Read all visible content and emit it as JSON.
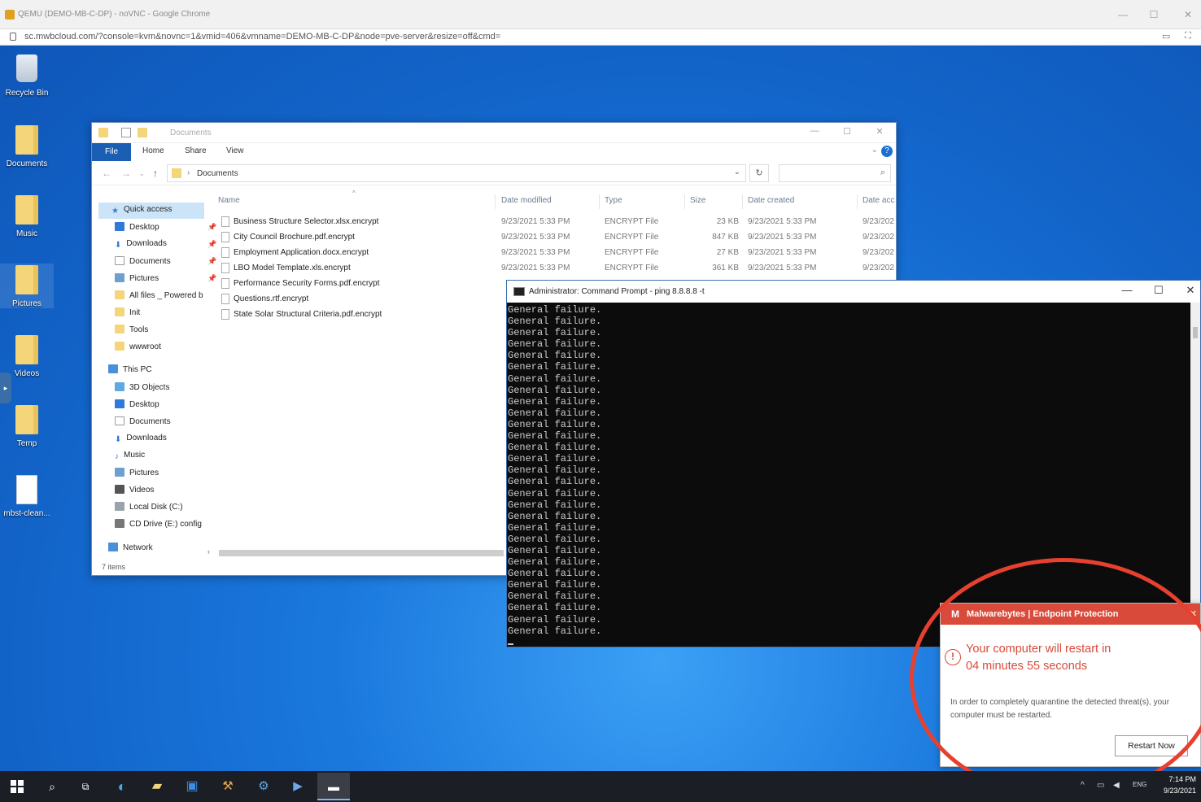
{
  "browser": {
    "title": "QEMU (DEMO-MB-C-DP) - noVNC - Google Chrome",
    "url": "sc.mwbcloud.com/?console=kvm&novnc=1&vmid=406&vmname=DEMO-MB-C-DP&node=pve-server&resize=off&cmd="
  },
  "desktop_icons": [
    {
      "label": "Recycle Bin",
      "icon": "recycle-bin-icon"
    },
    {
      "label": "Documents",
      "icon": "folder-icon"
    },
    {
      "label": "Music",
      "icon": "folder-icon"
    },
    {
      "label": "Pictures",
      "icon": "folder-icon"
    },
    {
      "label": "Videos",
      "icon": "folder-icon"
    },
    {
      "label": "Temp",
      "icon": "folder-icon"
    },
    {
      "label": "mbst-clean...",
      "icon": "file-icon"
    }
  ],
  "explorer": {
    "title": "Documents",
    "ribbon": {
      "file": "File",
      "home": "Home",
      "share": "Share",
      "view": "View"
    },
    "breadcrumb": "Documents",
    "nav": {
      "quick_access": "Quick access",
      "quick_items": [
        "Desktop",
        "Downloads",
        "Documents",
        "Pictures",
        "All files _ Powered b",
        "Init",
        "Tools",
        "wwwroot"
      ],
      "this_pc": "This PC",
      "pc_items": [
        "3D Objects",
        "Desktop",
        "Documents",
        "Downloads",
        "Music",
        "Pictures",
        "Videos",
        "Local Disk (C:)",
        "CD Drive (E:) config"
      ],
      "network": "Network"
    },
    "status": "7 items",
    "columns": {
      "name": "Name",
      "date_modified": "Date modified",
      "type": "Type",
      "size": "Size",
      "date_created": "Date created",
      "date_accessed": "Date acc"
    },
    "files": [
      {
        "name": "Business Structure Selector.xlsx.encrypt",
        "modified": "9/23/2021 5:33 PM",
        "type": "ENCRYPT File",
        "size": "23 KB",
        "created": "9/23/2021 5:33 PM",
        "accessed": "9/23/202"
      },
      {
        "name": "City Council Brochure.pdf.encrypt",
        "modified": "9/23/2021 5:33 PM",
        "type": "ENCRYPT File",
        "size": "847 KB",
        "created": "9/23/2021 5:33 PM",
        "accessed": "9/23/202"
      },
      {
        "name": "Employment Application.docx.encrypt",
        "modified": "9/23/2021 5:33 PM",
        "type": "ENCRYPT File",
        "size": "27 KB",
        "created": "9/23/2021 5:33 PM",
        "accessed": "9/23/202"
      },
      {
        "name": "LBO Model Template.xls.encrypt",
        "modified": "9/23/2021 5:33 PM",
        "type": "ENCRYPT File",
        "size": "361 KB",
        "created": "9/23/2021 5:33 PM",
        "accessed": "9/23/202"
      },
      {
        "name": "Performance Security Forms.pdf.encrypt",
        "modified": "",
        "type": "",
        "size": "",
        "created": "",
        "accessed": ""
      },
      {
        "name": "Questions.rtf.encrypt",
        "modified": "",
        "type": "",
        "size": "",
        "created": "",
        "accessed": ""
      },
      {
        "name": "State Solar Structural Criteria.pdf.encrypt",
        "modified": "",
        "type": "",
        "size": "",
        "created": "",
        "accessed": ""
      }
    ]
  },
  "cmd": {
    "title": "Administrator: Command Prompt - ping  8.8.8.8 -t",
    "line": "General failure.",
    "line_count": 29
  },
  "malwarebytes": {
    "header": "Malwarebytes | Endpoint Protection",
    "message_line1": "Your computer will restart in",
    "message_line2": "04 minutes 55 seconds",
    "body": "In order to completely quarantine the detected threat(s), your computer must be restarted.",
    "button": "Restart Now",
    "accent": "#d94a3a"
  },
  "taskbar": {
    "time": "7:14 PM",
    "date": "9/23/2021",
    "lang": "ENG"
  }
}
